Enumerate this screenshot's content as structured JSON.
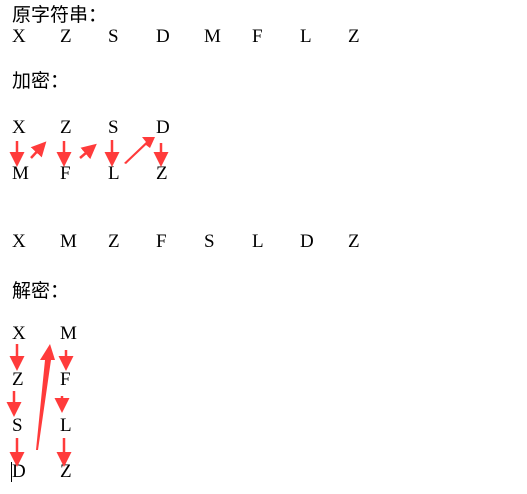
{
  "original": {
    "title": "原字符串：",
    "letters": [
      "X",
      "Z",
      "S",
      "D",
      "M",
      "F",
      "L",
      "Z"
    ]
  },
  "encrypt": {
    "title": "加密：",
    "row1": [
      "X",
      "Z",
      "S",
      "D"
    ],
    "row2": [
      "M",
      "F",
      "L",
      "Z"
    ],
    "result": [
      "X",
      "M",
      "Z",
      "F",
      "S",
      "L",
      "D",
      "Z"
    ]
  },
  "decrypt": {
    "title": "解密：",
    "col1": [
      "X",
      "Z",
      "S",
      "D"
    ],
    "col2": [
      "M",
      "F",
      "L",
      "Z"
    ]
  },
  "colors": {
    "arrow": "#ff3b3b",
    "text": "#000000"
  }
}
